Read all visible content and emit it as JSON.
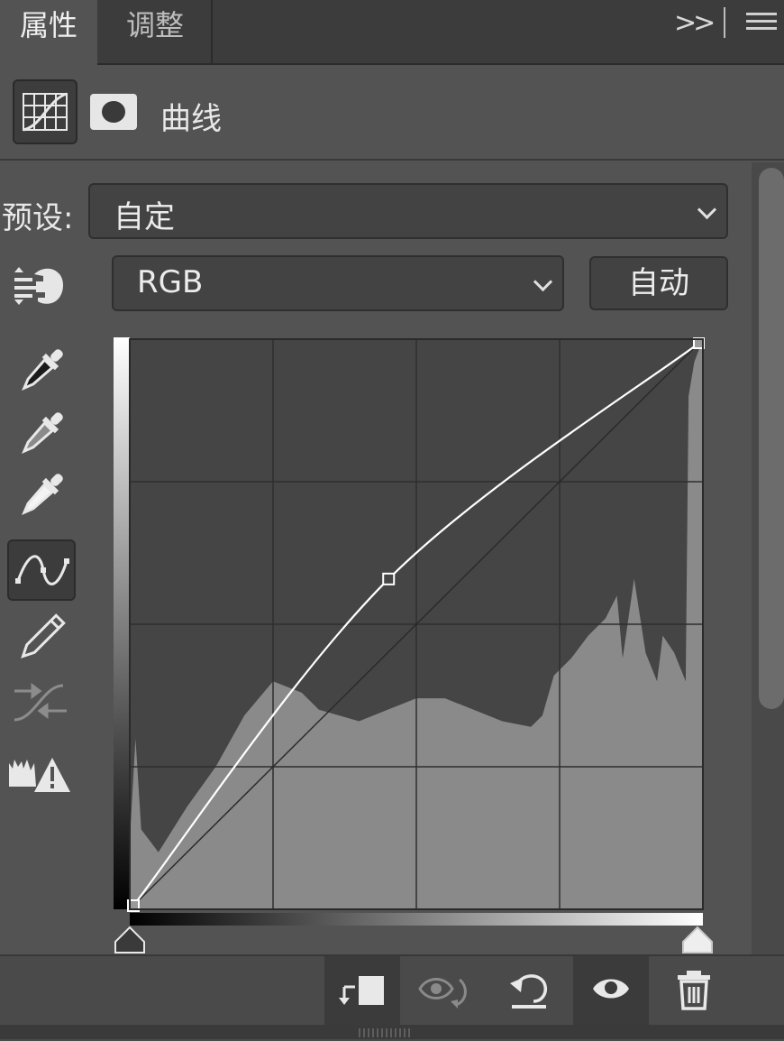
{
  "tabs": {
    "properties": "属性",
    "adjustments": "调整"
  },
  "collapse_glyph": ">>",
  "panel": {
    "title": "曲线"
  },
  "preset": {
    "label": "预设:",
    "value": "自定"
  },
  "channel": {
    "value": "RGB"
  },
  "auto_button": "自动",
  "icons": {
    "curves_adjustment": "curves-icon",
    "layer_mask": "mask-icon",
    "on_image": "hand-scrubby-icon",
    "black_point": "black-eyedropper-icon",
    "gray_point": "gray-eyedropper-icon",
    "white_point": "white-eyedropper-icon",
    "edit_points": "curve-points-icon",
    "draw": "pencil-icon",
    "smooth": "smooth-icon",
    "clipping": "clipping-warning-icon"
  },
  "curve": {
    "points": [
      [
        0,
        0
      ],
      [
        115,
        148
      ],
      [
        255,
        255
      ]
    ],
    "diagonal_baseline": true,
    "grid_divisions": 4
  },
  "footer": [
    "clip-to-layer-icon",
    "view-previous-state-icon",
    "reset-icon",
    "visibility-eye-icon",
    "trash-icon"
  ],
  "colors": {
    "panel_bg": "#535353",
    "graph_bg": "#454545",
    "histogram": "#8a8a8a",
    "curve": "#ffffff"
  }
}
